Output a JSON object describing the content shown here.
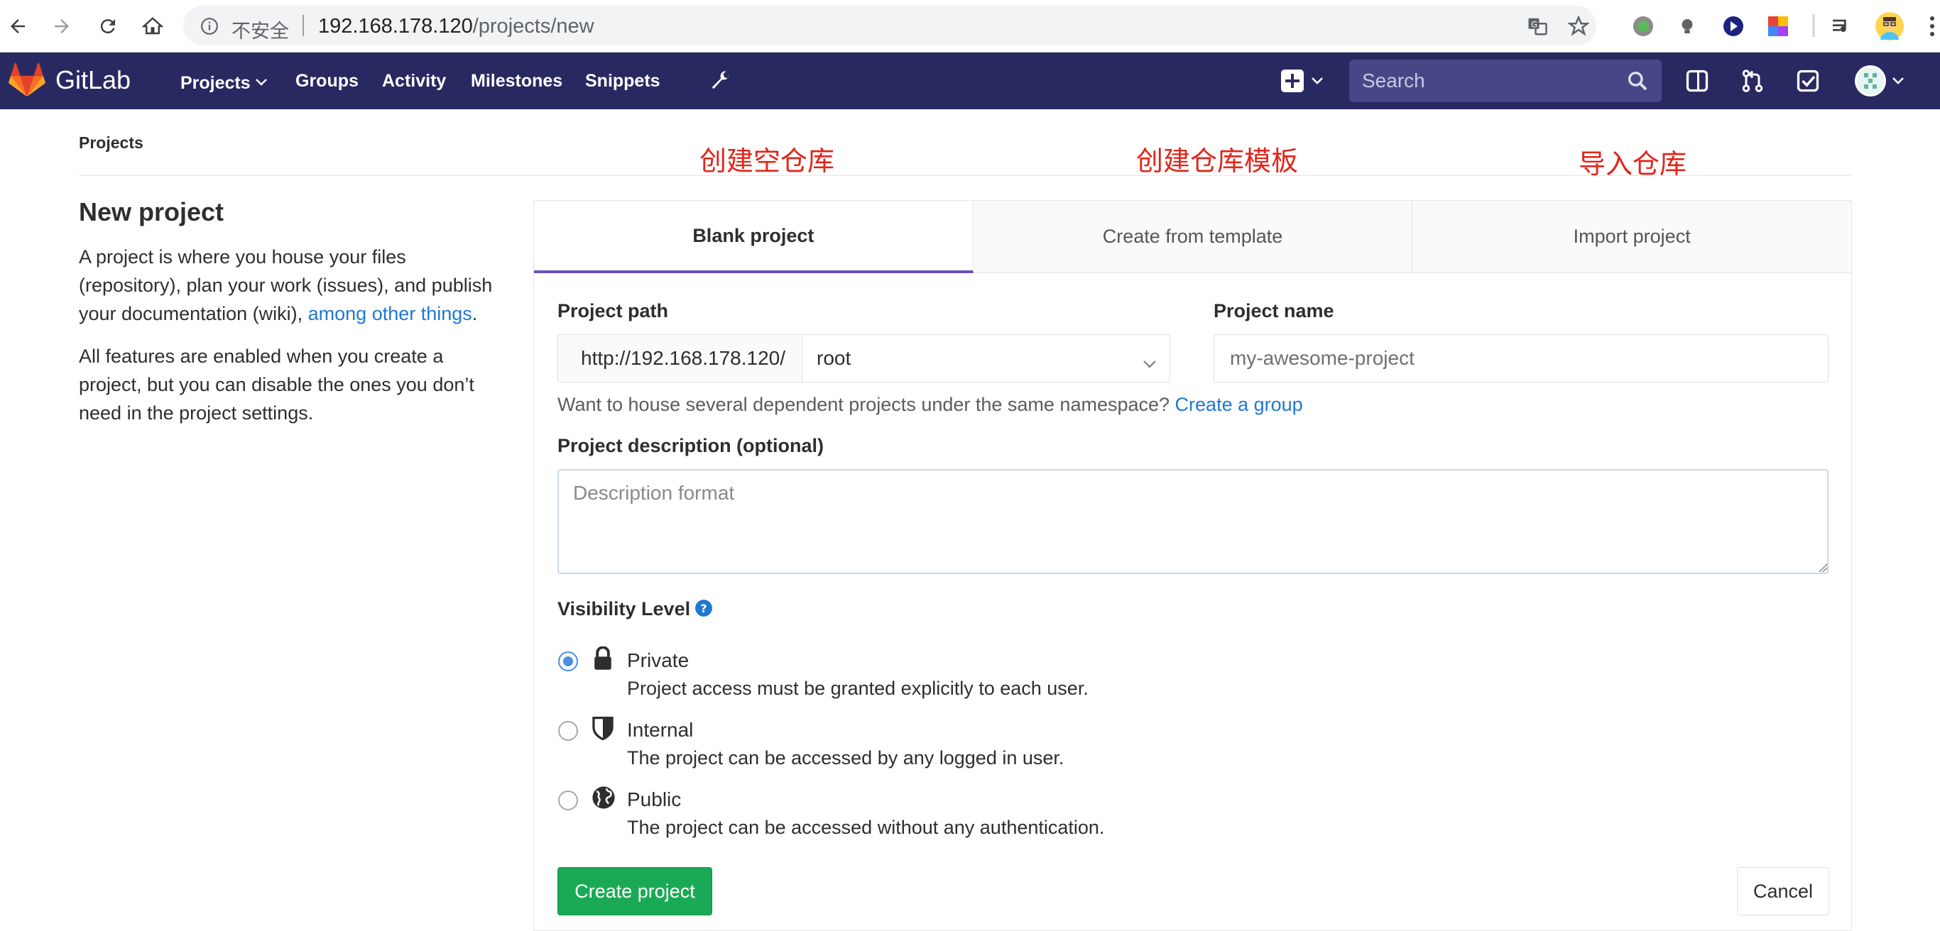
{
  "browser": {
    "security_label": "不安全",
    "url_host": "192.168.178.120",
    "url_path": "/projects/new"
  },
  "header": {
    "brand": "GitLab",
    "nav": {
      "projects": "Projects",
      "groups": "Groups",
      "activity": "Activity",
      "milestones": "Milestones",
      "snippets": "Snippets"
    },
    "search_placeholder": "Search"
  },
  "breadcrumb": "Projects",
  "annotations": {
    "blank": "创建空仓库",
    "template": "创建仓库模板",
    "import": "导入仓库"
  },
  "intro": {
    "title": "New project",
    "p1_text": "A project is where you house your files (repository), plan your work (issues), and publish your documentation (wiki), ",
    "p1_link": "among other things",
    "p1_end": ".",
    "p2": "All features are enabled when you create a project, but you can disable the ones you don’t need in the project settings."
  },
  "tabs": {
    "blank": "Blank project",
    "template": "Create from template",
    "import": "Import project"
  },
  "form": {
    "path_label": "Project path",
    "path_prefix": "http://192.168.178.120/",
    "namespace": "root",
    "name_label": "Project name",
    "name_placeholder": "my-awesome-project",
    "help_text": "Want to house several dependent projects under the same namespace? ",
    "help_link": "Create a group",
    "desc_label": "Project description (optional)",
    "desc_placeholder": "Description format",
    "visibility_label": "Visibility Level",
    "visibility": {
      "private_title": "Private",
      "private_desc": "Project access must be granted explicitly to each user.",
      "internal_title": "Internal",
      "internal_desc": "The project can be accessed by any logged in user.",
      "public_title": "Public",
      "public_desc": "The project can be accessed without any authentication.",
      "selected": "Private"
    },
    "create_label": "Create project",
    "cancel_label": "Cancel"
  },
  "colors": {
    "header_bg": "#292961",
    "active_tab": "#6b4fbb",
    "create_btn": "#1aaa55",
    "link": "#1f78d1",
    "annotation": "#e0261b"
  }
}
